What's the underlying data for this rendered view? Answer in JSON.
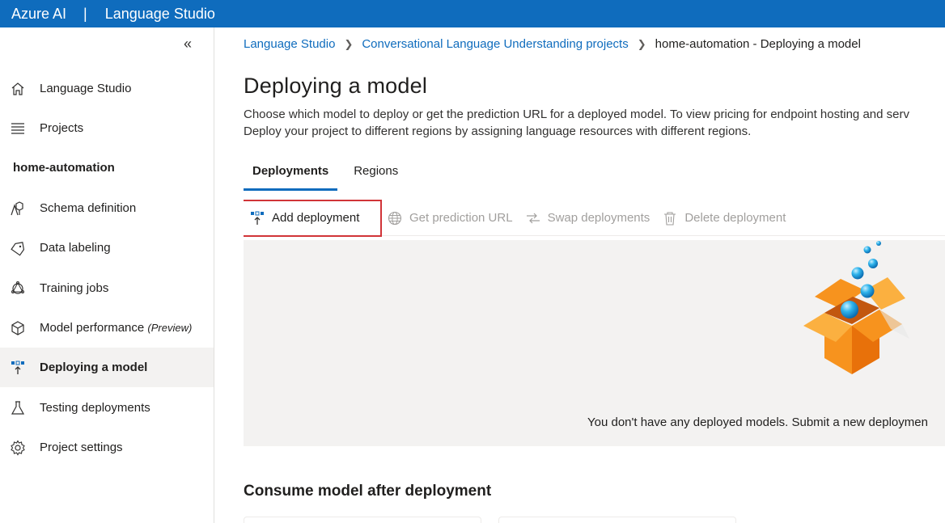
{
  "topbar": {
    "brand": "Azure AI",
    "separator": "|",
    "app_name": "Language Studio"
  },
  "sidebar": {
    "collapse_glyph": "«",
    "items": [
      {
        "label": "Language Studio",
        "icon": "home-icon"
      },
      {
        "label": "Projects",
        "icon": "list-icon"
      }
    ],
    "project_name": "home-automation",
    "project_items": [
      {
        "label": "Schema definition",
        "icon": "schema-icon"
      },
      {
        "label": "Data labeling",
        "icon": "tag-icon"
      },
      {
        "label": "Training jobs",
        "icon": "training-icon"
      },
      {
        "label": "Model performance",
        "suffix": "(Preview)",
        "icon": "cube-icon"
      },
      {
        "label": "Deploying a model",
        "icon": "deploy-icon",
        "active": true
      },
      {
        "label": "Testing deployments",
        "icon": "flask-icon"
      },
      {
        "label": "Project settings",
        "icon": "gear-icon"
      }
    ]
  },
  "breadcrumb": {
    "items": [
      "Language Studio",
      "Conversational Language Understanding projects"
    ],
    "current": "home-automation - Deploying a model"
  },
  "page": {
    "title": "Deploying a model",
    "description_line1": "Choose which model to deploy or get the prediction URL for a deployed model. To view pricing for endpoint hosting and serv",
    "description_line2": "Deploy your project to different regions by assigning language resources with different regions."
  },
  "tabs": [
    {
      "label": "Deployments",
      "active": true
    },
    {
      "label": "Regions",
      "active": false
    }
  ],
  "toolbar": {
    "add": "Add deployment",
    "get_url": "Get prediction URL",
    "swap": "Swap deployments",
    "delete": "Delete deployment"
  },
  "empty_state": {
    "message": "You don't have any deployed models. Submit a new deploymen",
    "illustration": "open-box-illustration"
  },
  "consume": {
    "title": "Consume model after deployment"
  },
  "colors": {
    "accent": "#0f6cbd",
    "highlight": "#d13438",
    "box_orange": "#f7931e"
  }
}
